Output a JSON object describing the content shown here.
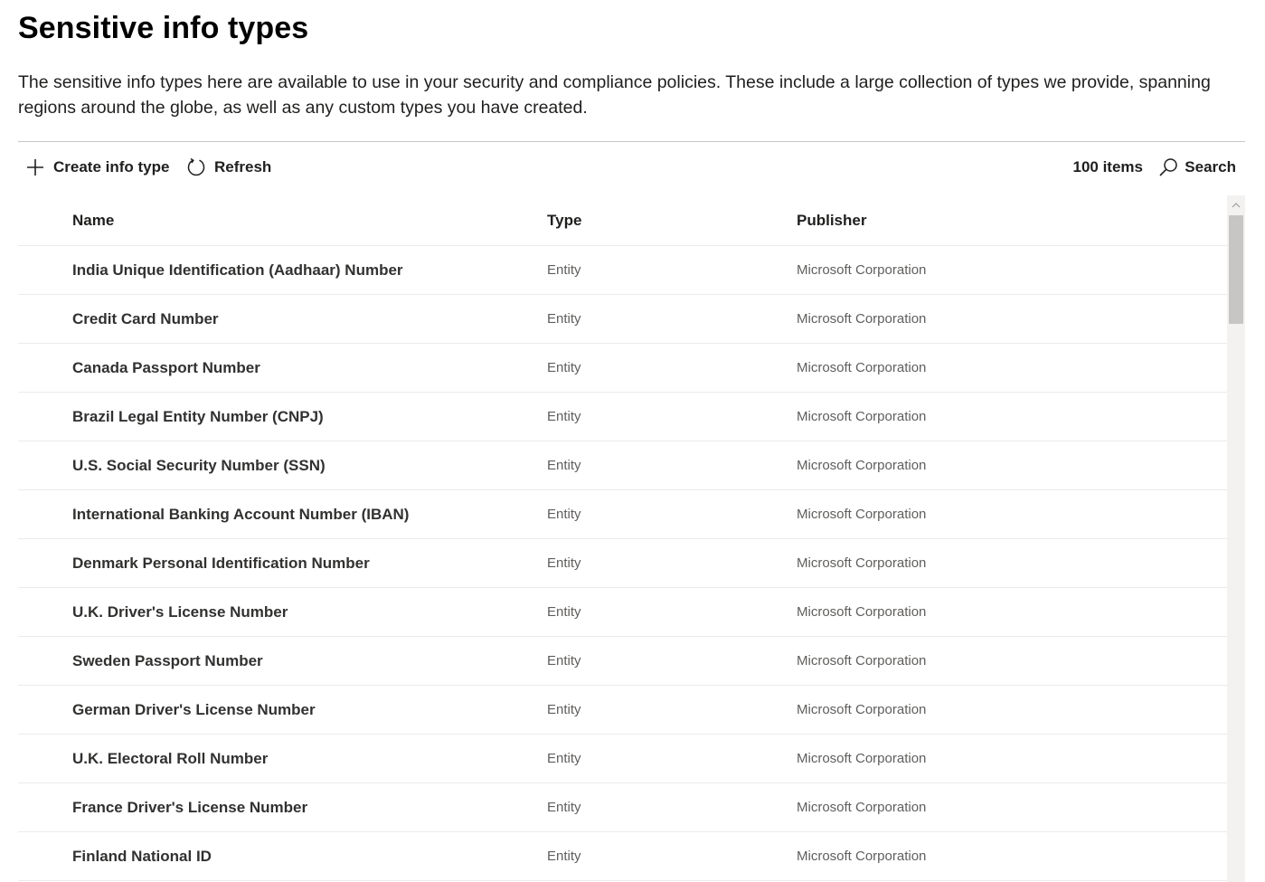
{
  "page": {
    "title": "Sensitive info types",
    "description": "The sensitive info types here are available to use in your security and compliance policies. These include a large collection of types we provide, spanning regions around the globe, as well as any custom types you have created."
  },
  "toolbar": {
    "create_label": "Create info type",
    "create_icon": "plus-icon",
    "refresh_label": "Refresh",
    "refresh_icon": "refresh-icon",
    "item_count": "100 items",
    "search_label": "Search",
    "search_icon": "search-icon"
  },
  "table": {
    "columns": {
      "name": "Name",
      "type": "Type",
      "publisher": "Publisher"
    },
    "rows": [
      {
        "name": "India Unique Identification (Aadhaar) Number",
        "type": "Entity",
        "publisher": "Microsoft Corporation"
      },
      {
        "name": "Credit Card Number",
        "type": "Entity",
        "publisher": "Microsoft Corporation"
      },
      {
        "name": "Canada Passport Number",
        "type": "Entity",
        "publisher": "Microsoft Corporation"
      },
      {
        "name": "Brazil Legal Entity Number (CNPJ)",
        "type": "Entity",
        "publisher": "Microsoft Corporation"
      },
      {
        "name": "U.S. Social Security Number (SSN)",
        "type": "Entity",
        "publisher": "Microsoft Corporation"
      },
      {
        "name": "International Banking Account Number (IBAN)",
        "type": "Entity",
        "publisher": "Microsoft Corporation"
      },
      {
        "name": "Denmark Personal Identification Number",
        "type": "Entity",
        "publisher": "Microsoft Corporation"
      },
      {
        "name": "U.K. Driver's License Number",
        "type": "Entity",
        "publisher": "Microsoft Corporation"
      },
      {
        "name": "Sweden Passport Number",
        "type": "Entity",
        "publisher": "Microsoft Corporation"
      },
      {
        "name": "German Driver's License Number",
        "type": "Entity",
        "publisher": "Microsoft Corporation"
      },
      {
        "name": "U.K. Electoral Roll Number",
        "type": "Entity",
        "publisher": "Microsoft Corporation"
      },
      {
        "name": "France Driver's License Number",
        "type": "Entity",
        "publisher": "Microsoft Corporation"
      },
      {
        "name": "Finland National ID",
        "type": "Entity",
        "publisher": "Microsoft Corporation"
      }
    ]
  },
  "scrollbar": {
    "up_icon": "chevron-up-icon"
  },
  "colors": {
    "text": "#201f1e",
    "secondary_text": "#605e5c",
    "divider": "#edebe9",
    "scroll_track": "#f3f2f1",
    "scroll_thumb": "#c8c6c4"
  }
}
